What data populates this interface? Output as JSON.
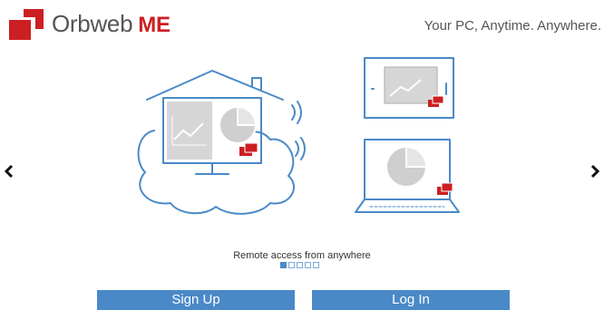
{
  "brand": {
    "name": "Orbweb",
    "suffix": "ME",
    "accent": "#cc1f22",
    "primary": "#4a89c8"
  },
  "header": {
    "tagline": "Your PC, Anytime. Anywhere."
  },
  "carousel": {
    "caption": "Remote access from anywhere",
    "slide_count": 5,
    "active_slide": 1,
    "prev_icon": "chevron-left-icon",
    "next_icon": "chevron-right-icon"
  },
  "actions": {
    "signup_label": "Sign Up",
    "login_label": "Log In"
  }
}
